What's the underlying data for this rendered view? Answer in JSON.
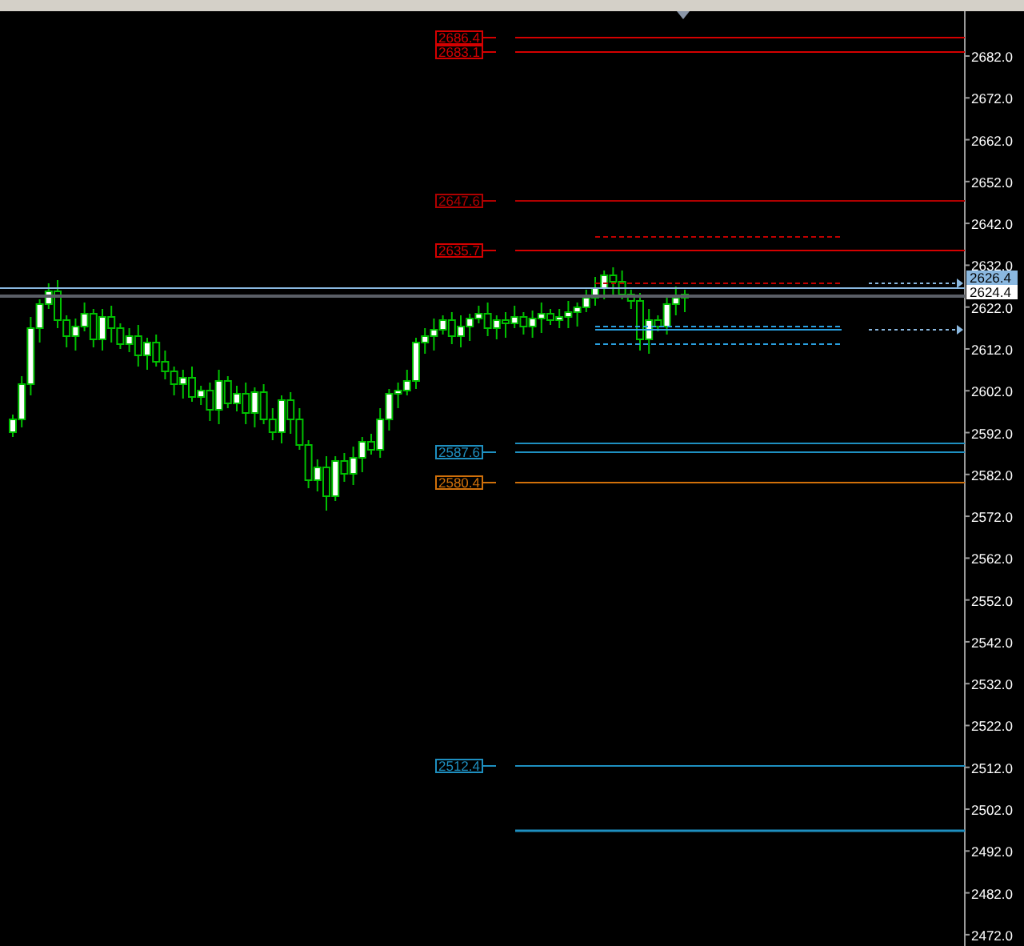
{
  "chart": {
    "price_axis": {
      "ticks": [
        "2682.0",
        "2672.0",
        "2662.0",
        "2652.0",
        "2642.0",
        "2632.0",
        "2622.0",
        "2612.0",
        "2602.0",
        "2592.0",
        "2582.0",
        "2572.0",
        "2562.0",
        "2552.0",
        "2542.0",
        "2532.0",
        "2522.0",
        "2512.0",
        "2502.0",
        "2492.0",
        "2482.0",
        "2472.0"
      ]
    },
    "levels": [
      {
        "label": "2686.4",
        "color": "#d40000"
      },
      {
        "label": "2683.1",
        "color": "#d40000"
      },
      {
        "label": "2647.6",
        "color": "#b00000"
      },
      {
        "label": "2635.7",
        "color": "#d40000"
      },
      {
        "label": "2587.6",
        "color": "#1e8fc0"
      },
      {
        "label": "2580.4",
        "color": "#d0700a"
      },
      {
        "label": "2512.4",
        "color": "#1e8fc0"
      }
    ],
    "ask": {
      "label": "2626.4"
    },
    "bid": {
      "label": "2624.4"
    }
  }
}
